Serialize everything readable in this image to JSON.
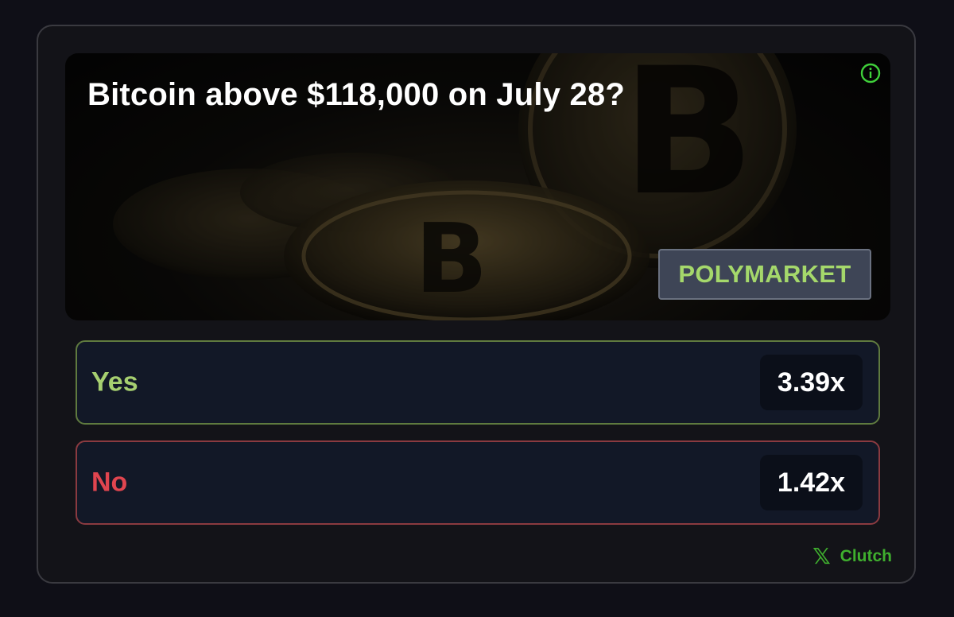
{
  "market": {
    "question": "Bitcoin above $118,000 on July 28?",
    "source": "POLYMARKET"
  },
  "options": [
    {
      "label": "Yes",
      "odds": "3.39x",
      "color": "#a6cf70"
    },
    {
      "label": "No",
      "odds": "1.42x",
      "color": "#e0454f"
    }
  ],
  "footer": {
    "brand_icon": "x-logo-icon",
    "brand_glyph": "𝕏",
    "brand_name": "Clutch"
  },
  "icons": {
    "info": "info-icon"
  },
  "colors": {
    "background": "#0f0f17",
    "accent_green": "#3fae2e",
    "badge_text": "#a5d86b"
  }
}
